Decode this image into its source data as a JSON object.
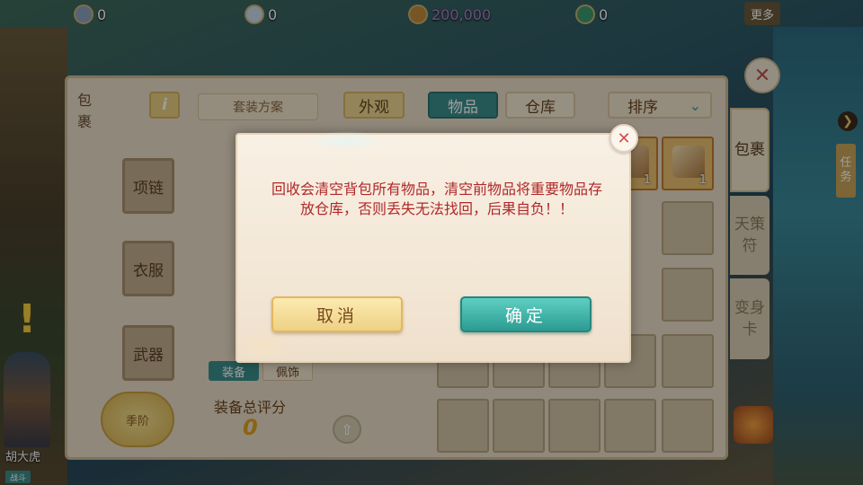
{
  "resources": [
    {
      "icon": "cloud-coin-icon",
      "value": "0"
    },
    {
      "icon": "silver-ingot-icon",
      "value": "0"
    },
    {
      "icon": "gold-coin-icon",
      "value": "200,000"
    },
    {
      "icon": "jade-icon",
      "value": "0"
    }
  ],
  "top_right": {
    "more_label": "更多"
  },
  "panel": {
    "side_tab": "包裹",
    "info_label": "i",
    "plan_label": "套装方案",
    "look_label": "外观",
    "items_tab": "物品",
    "store_tab": "仓库",
    "sort_label": "排序",
    "equip_slots": [
      "项链",
      "衣服",
      "武器"
    ],
    "equip_tabs": [
      "装备",
      "佩饰"
    ],
    "score_label": "装备总评分",
    "score_value": "0",
    "tier_label": "季阶",
    "item_counts": [
      "1",
      "1"
    ]
  },
  "right_tabs": [
    "包裹",
    "天策符",
    "变身卡"
  ],
  "task_tab": "任务",
  "character": {
    "name": "胡大虎",
    "badge": "战斗"
  },
  "modal": {
    "message": "回收会清空背包所有物品，清空前物品将重要物品存放仓库，否则丢失无法找回，后果自负！！",
    "cancel_label": "取消",
    "confirm_label": "确定"
  },
  "colors": {
    "accent_teal": "#3a8e8c",
    "warning_red": "#b0282a",
    "gold": "#e0a020"
  }
}
